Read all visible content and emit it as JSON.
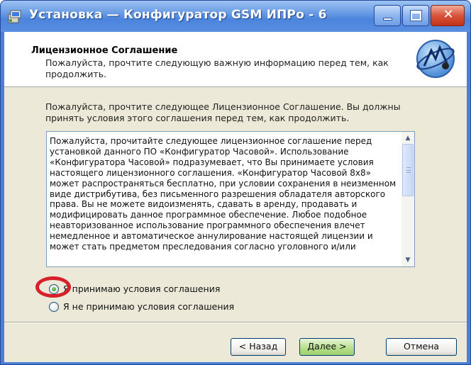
{
  "window": {
    "title": "Установка — Конфигуратор GSM ИПРо - 6",
    "close_glyph": "✕"
  },
  "header": {
    "title": "Лицензионное Соглашение",
    "subtitle": "Пожалуйста, прочтите следующую важную информацию перед тем, как продолжить."
  },
  "intro_text": "Пожалуйста, прочтите следующее Лицензионное Соглашение. Вы должны принять условия этого соглашения перед тем, как продолжить.",
  "license_text": "Пожалуйста, прочитайте следующее лицензионное соглашение перед установкой данного ПО «Конфигуратор Часовой». Использование «Конфигуратора Часовой» подразумевает, что Вы принимаете условия настоящего лицензионного соглашения. «Конфигуратор Часовой 8х8» может распространяться бесплатно, при условии сохранения в неизменном виде дистрибутива, без письменного разрешения обладателя авторского права. Вы не можете видоизменять, сдавать в аренду, продавать и модифицировать данное программное обеспечение. Любое подобное неавторизованное использование программного обеспечения влечет немедленное и автоматическое аннулирование настоящей лицензии и может стать предметом преследования согласно уголовного и/или",
  "scrollbar": {
    "up_glyph": "▲",
    "down_glyph": "▼"
  },
  "options": {
    "accept_label": "Я принимаю условия соглашения",
    "decline_label": "Я не принимаю условия соглашения",
    "selected": "accept"
  },
  "buttons": {
    "back": "< Назад",
    "next": "Далее >",
    "cancel": "Отмена"
  },
  "icons": [
    "installer-icon",
    "minimize-icon",
    "maximize-icon",
    "close-icon",
    "gsm-logo-icon"
  ],
  "colors": {
    "highlight_ring": "#d6202a",
    "titlebar": "#4b84dd"
  }
}
